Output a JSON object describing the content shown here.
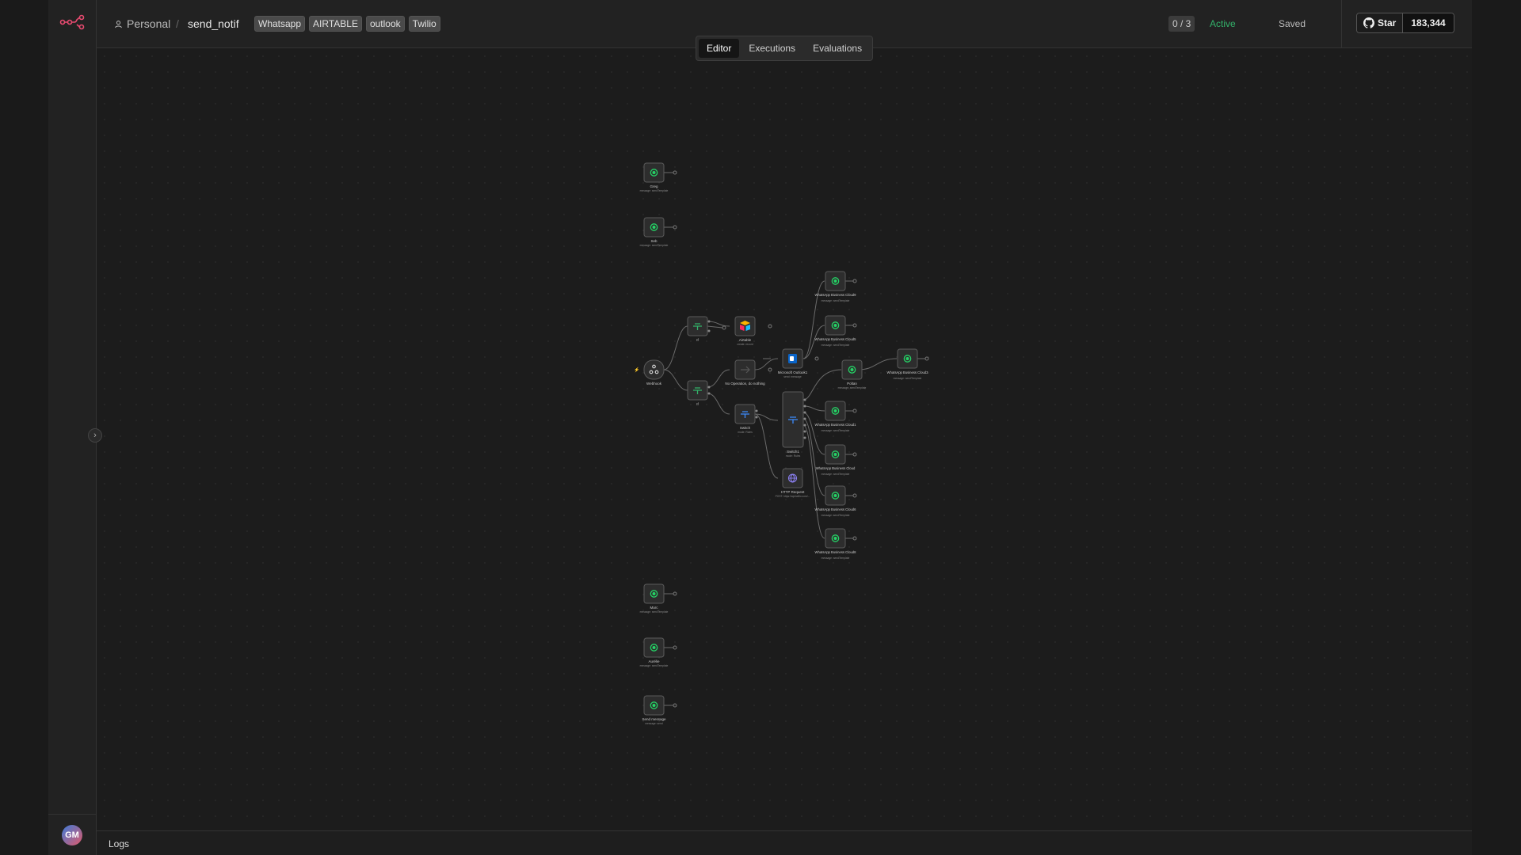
{
  "header": {
    "project": "Personal",
    "workflow_name": "send_notif",
    "tags": [
      "Whatsapp",
      "AIRTABLE",
      "outlook",
      "Twilio"
    ],
    "counter": "0 / 3",
    "status": "Active",
    "save_state": "Saved",
    "github": {
      "star_label": "Star",
      "star_count": "183,344"
    }
  },
  "tabs": [
    "Editor",
    "Executions",
    "Evaluations"
  ],
  "active_tab": "Editor",
  "sidebar": {
    "avatar_initials": "GM"
  },
  "logs": {
    "label": "Logs"
  },
  "nodes": {
    "greg": {
      "title": "Greg",
      "subtitle": "message: sendTemplate"
    },
    "seb": {
      "title": "Seb",
      "subtitle": "message: sendTemplate"
    },
    "webhook": {
      "title": "Webhook"
    },
    "if1": {
      "title": "If"
    },
    "if2": {
      "title": "If"
    },
    "airtable": {
      "title": "Airtable",
      "subtitle": "create: record"
    },
    "noop": {
      "title": "No Operation, do nothing"
    },
    "switch1": {
      "title": "Switch",
      "subtitle": "mode: Rules"
    },
    "outlook": {
      "title": "Microsoft Outlook1",
      "subtitle": "send: message"
    },
    "switch2": {
      "title": "Switch1",
      "subtitle": "mode: Rules"
    },
    "http": {
      "title": "HTTP Request",
      "subtitle": "POST: https://api.twilio.com/..."
    },
    "wa1": {
      "title": "WhatsApp Business Cloud9",
      "subtitle": "message: sendTemplate"
    },
    "wa2": {
      "title": "WhatsApp Business Cloud5",
      "subtitle": "message: sendTemplate"
    },
    "poltan": {
      "title": "Poltan",
      "subtitle": "message: sendTemplate"
    },
    "wa_right": {
      "title": "WhatsApp Business Cloud3",
      "subtitle": "message: sendTemplate"
    },
    "wa3": {
      "title": "WhatsApp Business Cloud1",
      "subtitle": "message: sendTemplate"
    },
    "wa4": {
      "title": "WhatsApp Business Cloud",
      "subtitle": "message: sendTemplate"
    },
    "wa5": {
      "title": "WhatsApp Business Cloud6",
      "subtitle": "message: sendTemplate"
    },
    "wa6": {
      "title": "WhatsApp Business Cloud8",
      "subtitle": "message: sendTemplate"
    },
    "marc": {
      "title": "Marc",
      "subtitle": "message: sendTemplate"
    },
    "aurelie": {
      "title": "Aurélie",
      "subtitle": "message: sendTemplate"
    },
    "send_message": {
      "title": "Send message",
      "subtitle": "message: send"
    }
  },
  "colors": {
    "accent": "#ea4b71",
    "active": "#33b26a",
    "whatsapp": "#25d366"
  }
}
